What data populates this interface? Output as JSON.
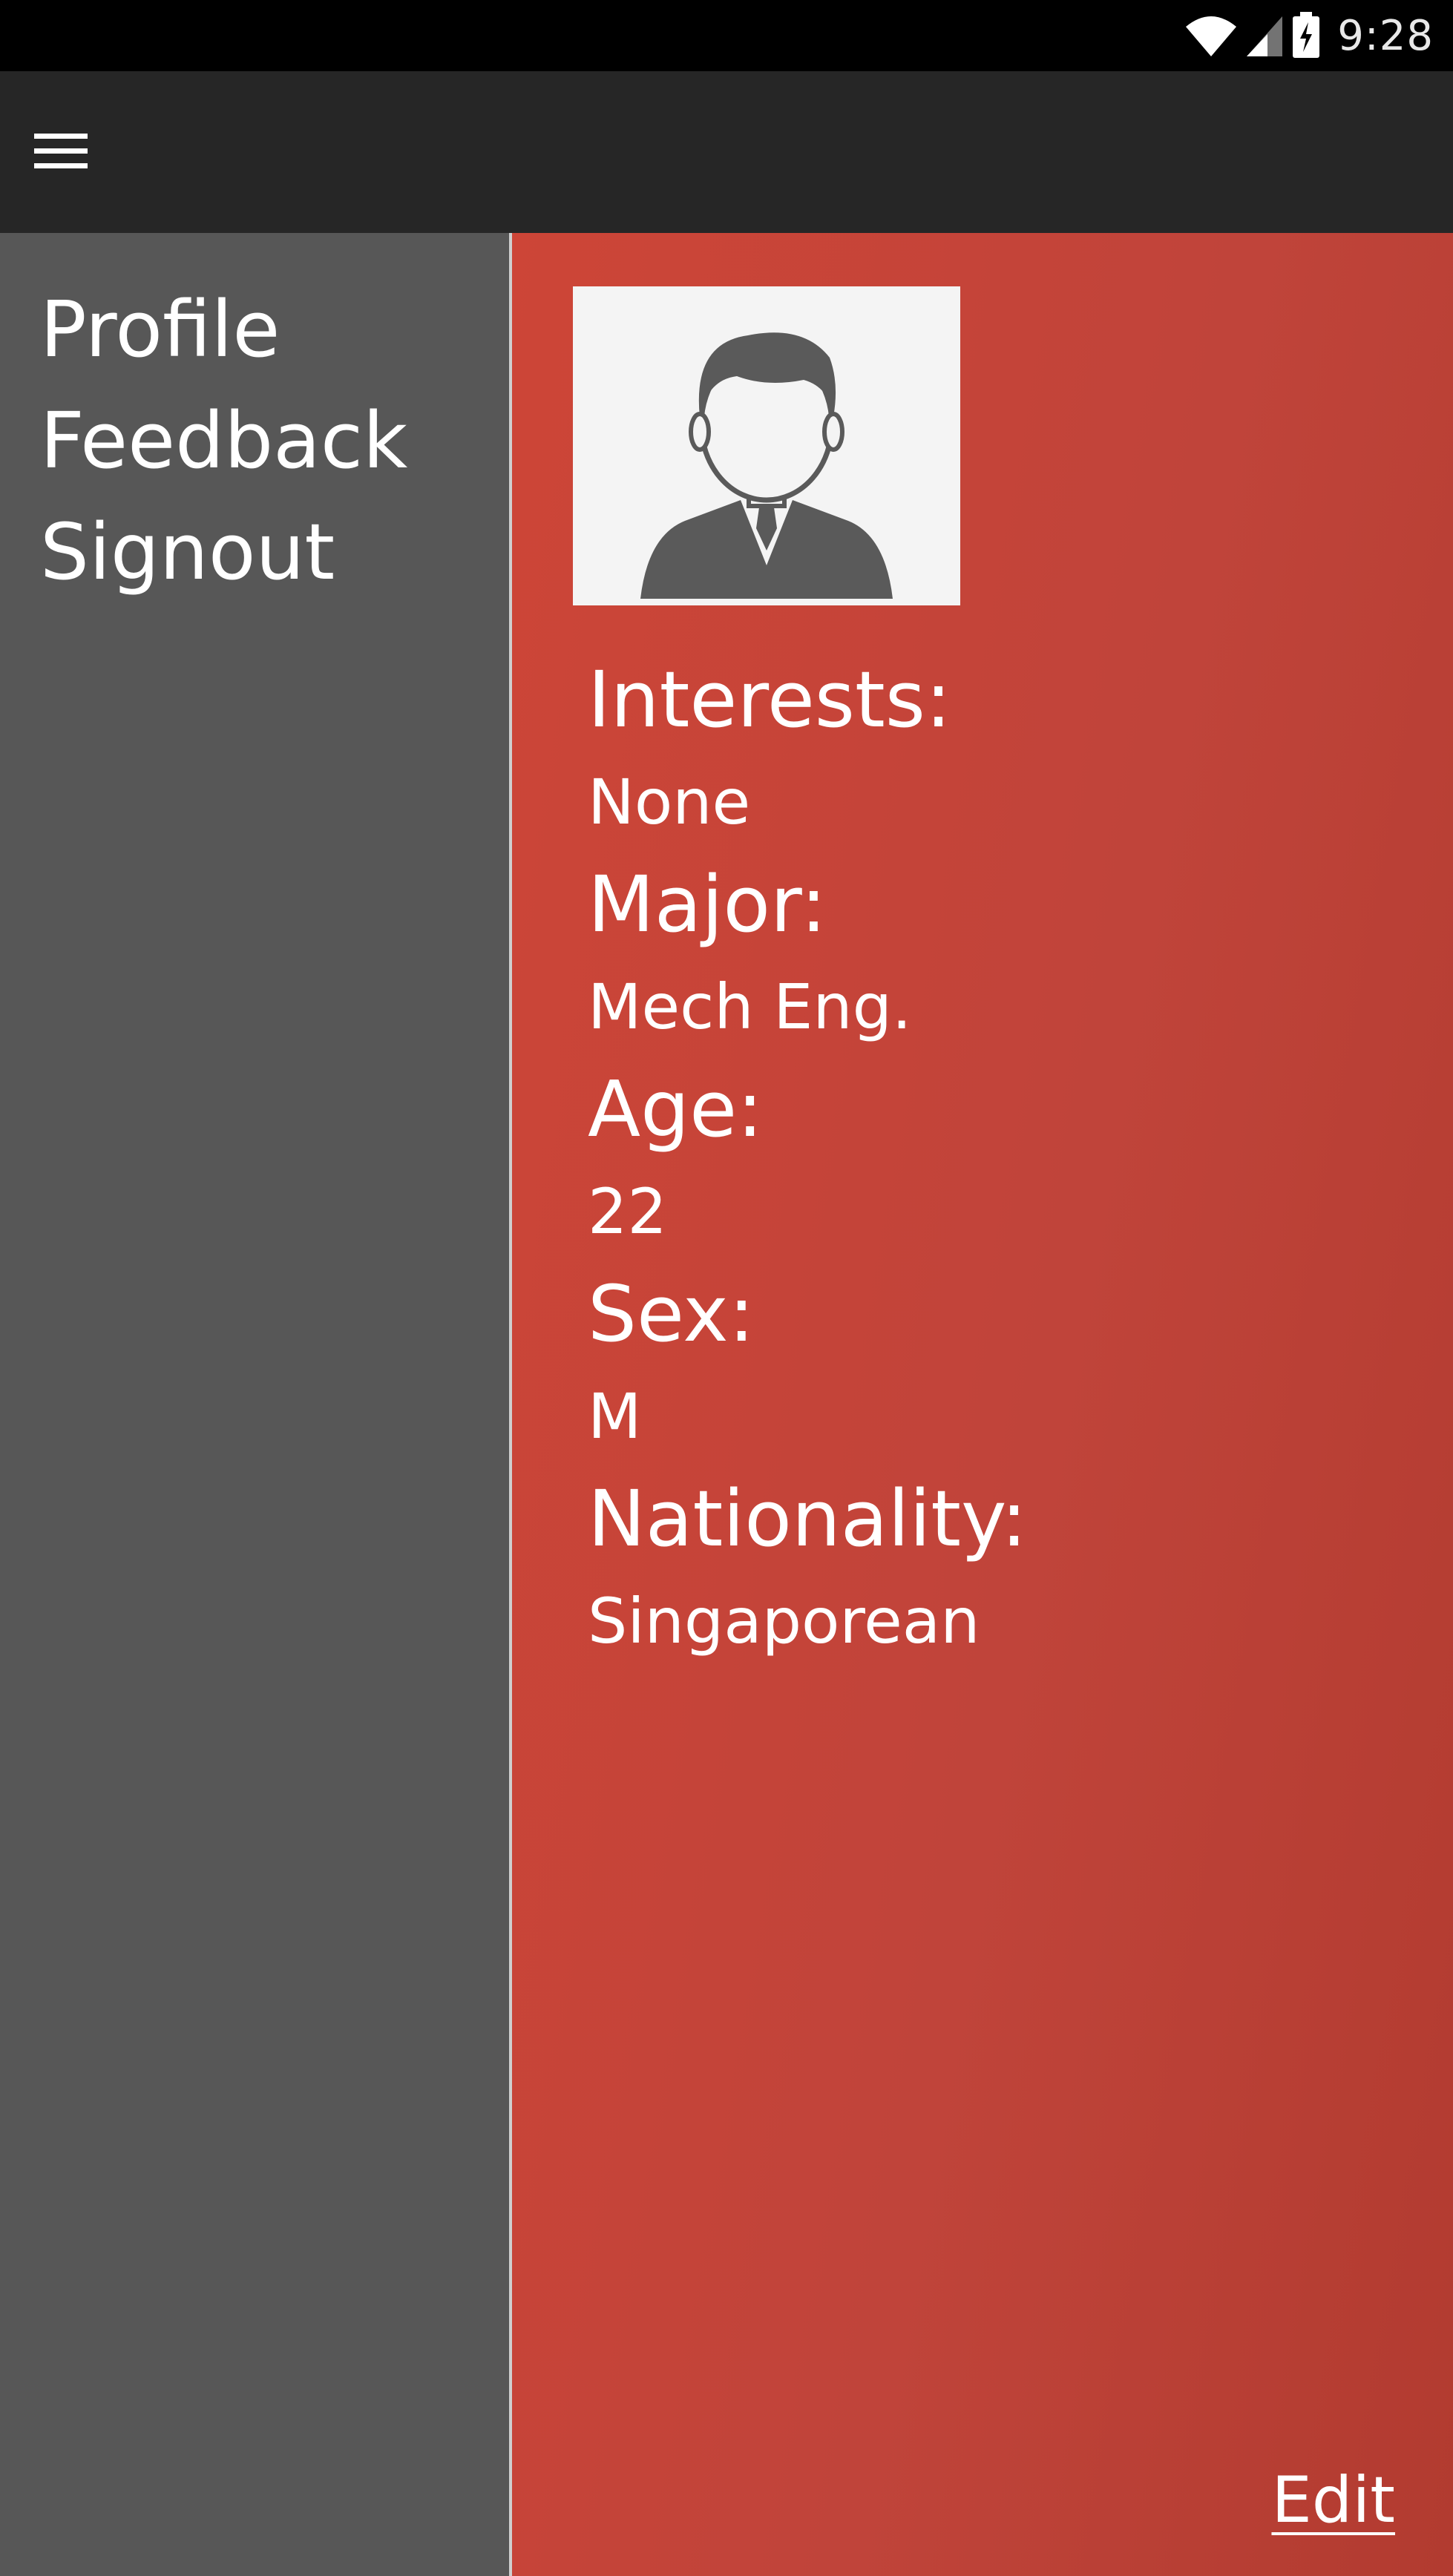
{
  "status_bar": {
    "time": "9:28",
    "icons": [
      "wifi-icon",
      "cell-signal-icon",
      "battery-charging-icon"
    ]
  },
  "app_bar": {
    "menu_icon": "hamburger-menu-icon"
  },
  "drawer": {
    "items": [
      {
        "label": "Profile"
      },
      {
        "label": "Feedback"
      },
      {
        "label": "Signout"
      }
    ]
  },
  "profile": {
    "avatar_icon": "user-avatar-icon",
    "fields": [
      {
        "label": "Interests:",
        "value": "None"
      },
      {
        "label": "Major:",
        "value": "Mech Eng."
      },
      {
        "label": "Age:",
        "value": "22"
      },
      {
        "label": "Sex:",
        "value": "M"
      },
      {
        "label": "Nationality:",
        "value": "Singaporean"
      }
    ],
    "edit_label": "Edit"
  },
  "colors": {
    "status_bar": "#000000",
    "app_bar": "#262626",
    "drawer": "#575757",
    "accent": "#c4443a",
    "avatar_bg": "#f4f4f4",
    "avatar_fg": "#5a5a5a"
  }
}
